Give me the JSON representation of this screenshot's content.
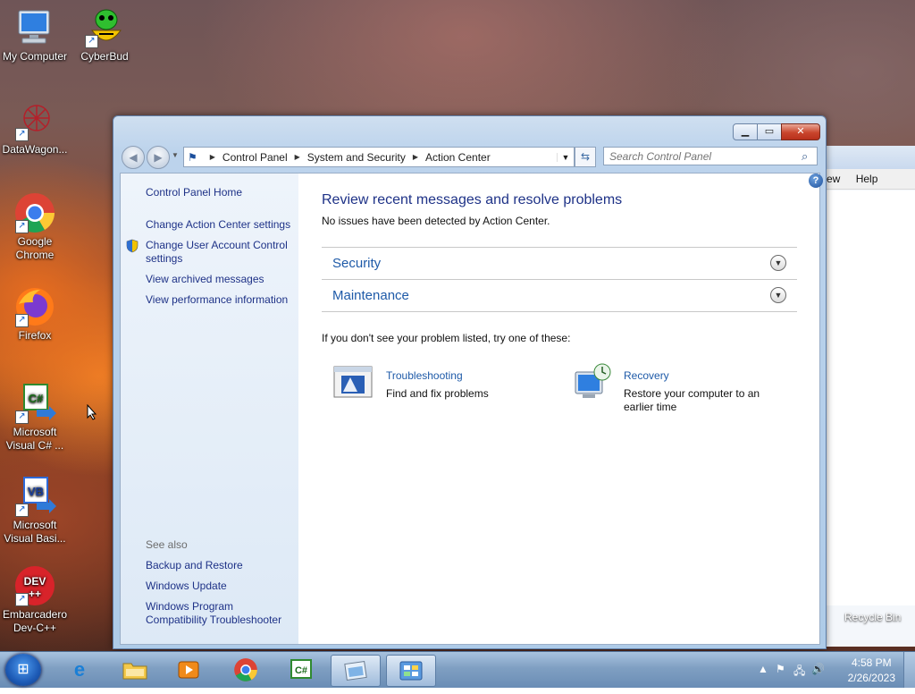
{
  "desktop": {
    "icons": [
      {
        "label": "My Computer"
      },
      {
        "label": "CyberBud"
      },
      {
        "label": "DataWagon..."
      },
      {
        "label": "Google Chrome"
      },
      {
        "label": "Firefox"
      },
      {
        "label": "Microsoft Visual C# ..."
      },
      {
        "label": "Microsoft Visual Basi..."
      },
      {
        "label": "Embarcadero Dev-C++"
      }
    ],
    "recycle_bin": "Recycle Bin"
  },
  "background_window": {
    "menu": [
      "ew",
      "Help"
    ]
  },
  "window": {
    "breadcrumb": [
      "Control Panel",
      "System and Security",
      "Action Center"
    ],
    "search_placeholder": "Search Control Panel",
    "left_pane": {
      "home": "Control Panel Home",
      "links": [
        "Change Action Center settings",
        "Change User Account Control settings",
        "View archived messages",
        "View performance information"
      ],
      "see_also_label": "See also",
      "see_also": [
        "Backup and Restore",
        "Windows Update",
        "Windows Program Compatibility Troubleshooter"
      ]
    },
    "main": {
      "title": "Review recent messages and resolve problems",
      "status": "No issues have been detected by Action Center.",
      "sections": [
        "Security",
        "Maintenance"
      ],
      "hint": "If you don't see your problem listed, try one of these:",
      "tools": [
        {
          "title": "Troubleshooting",
          "desc": "Find and fix problems"
        },
        {
          "title": "Recovery",
          "desc": "Restore your computer to an earlier time"
        }
      ]
    }
  },
  "taskbar": {
    "time": "4:58 PM",
    "date": "2/26/2023"
  }
}
